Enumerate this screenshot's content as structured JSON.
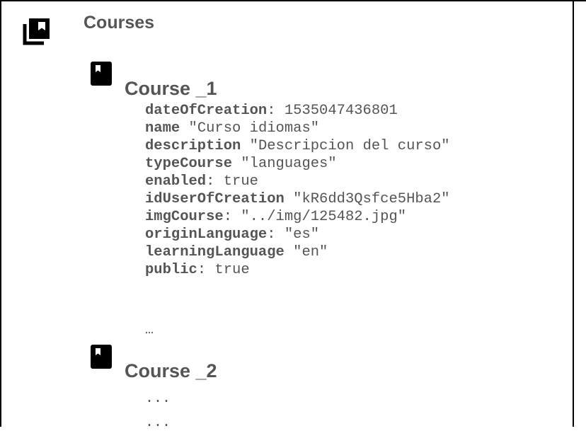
{
  "root": {
    "label": "Courses",
    "icon": "library-books-icon"
  },
  "course1": {
    "label": "Course _1",
    "icon": "bookmark-book-icon",
    "fields": [
      {
        "key": "dateOfCreation",
        "sep": ": ",
        "value": "1535047436801"
      },
      {
        "key": "name",
        "sep": " ",
        "value": "\"Curso idiomas\""
      },
      {
        "key": "description",
        "sep": " ",
        "value": "\"Descripcion del curso\""
      },
      {
        "key": "typeCourse",
        "sep": " ",
        "value": "\"languages\""
      },
      {
        "key": "enabled",
        "sep": ": ",
        "value": "true"
      },
      {
        "key": "idUserOfCreation",
        "sep": " ",
        "value": "\"kR6dd3Qsfce5Hba2\""
      },
      {
        "key": "imgCourse",
        "sep": ": ",
        "value": "\"../img/125482.jpg\""
      },
      {
        "key": "originLanguage",
        "sep": ": ",
        "value": "\"es\""
      },
      {
        "key": "learningLanguage",
        "sep": " ",
        "value": "\"en\""
      },
      {
        "key": "public",
        "sep": ": ",
        "value": "true"
      }
    ],
    "more": "…"
  },
  "course2": {
    "label": "Course _2",
    "icon": "bookmark-book-icon",
    "more1": "...",
    "more2": "..."
  }
}
